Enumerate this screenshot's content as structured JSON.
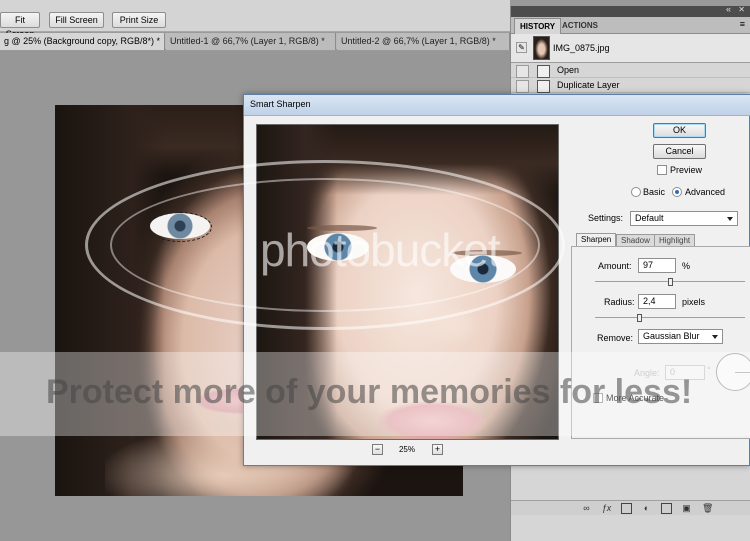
{
  "toolbar": {
    "fit_screen": "Fit Screen",
    "fill_screen": "Fill Screen",
    "print_size": "Print Size"
  },
  "doc_tabs": [
    {
      "label": "g @ 25% (Background copy, RGB/8*) *"
    },
    {
      "label": "Untitled-1 @ 66,7% (Layer 1, RGB/8) *"
    },
    {
      "label": "Untitled-2 @ 66,7% (Layer 1, RGB/8) *"
    }
  ],
  "history_panel": {
    "tab_history": "HISTORY",
    "tab_actions": "ACTIONS",
    "snapshot_name": "IMG_0875.jpg",
    "steps": [
      "Open",
      "Duplicate Layer"
    ]
  },
  "dialog": {
    "title": "Smart Sharpen",
    "ok": "OK",
    "cancel": "Cancel",
    "preview_label": "Preview",
    "mode_basic": "Basic",
    "mode_advanced": "Advanced",
    "settings_label": "Settings:",
    "settings_value": "Default",
    "tabs": [
      "Sharpen",
      "Shadow",
      "Highlight"
    ],
    "amount_label": "Amount:",
    "amount_value": "97",
    "amount_unit": "%",
    "amount_fraction": 0.485,
    "radius_label": "Radius:",
    "radius_value": "2,4",
    "radius_unit": "pixels",
    "radius_fraction": 0.04,
    "remove_label": "Remove:",
    "remove_value": "Gaussian Blur",
    "angle_label": "Angle:",
    "angle_value": "0",
    "angle_unit": "°",
    "more_accurate": "More Accurate",
    "zoom_minus": "−",
    "zoom_plus": "+",
    "zoom_value": "25%"
  },
  "watermark": {
    "logo": "photobucket",
    "text": "Protect more of your memories for less!"
  }
}
